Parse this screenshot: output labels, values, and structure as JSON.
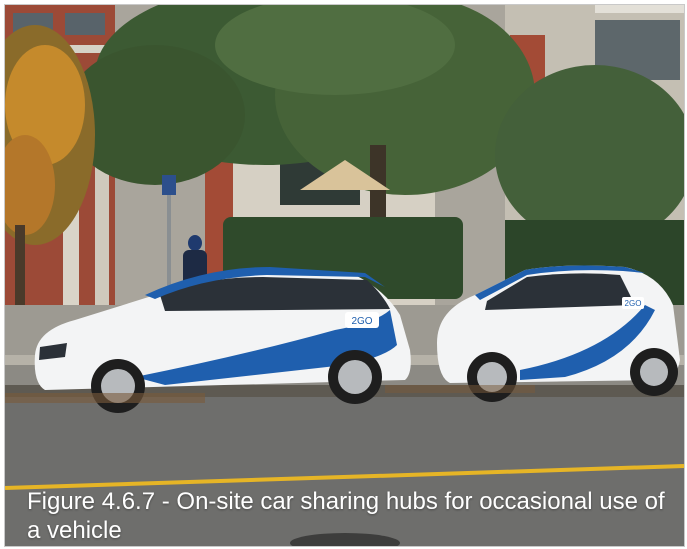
{
  "figure": {
    "caption": "Figure 4.6.7 - On-site car sharing hubs for occasional use of a vehicle"
  },
  "photo": {
    "car_decal_left": "2GO",
    "car_decal_right": "2GO"
  },
  "colors": {
    "car_body": "#f4f5f6",
    "car_accent": "#1f5fae",
    "road": "#6f6f6d",
    "road_line": "#e6b526",
    "foliage": "#3f5a34",
    "brick": "#a34b36"
  }
}
